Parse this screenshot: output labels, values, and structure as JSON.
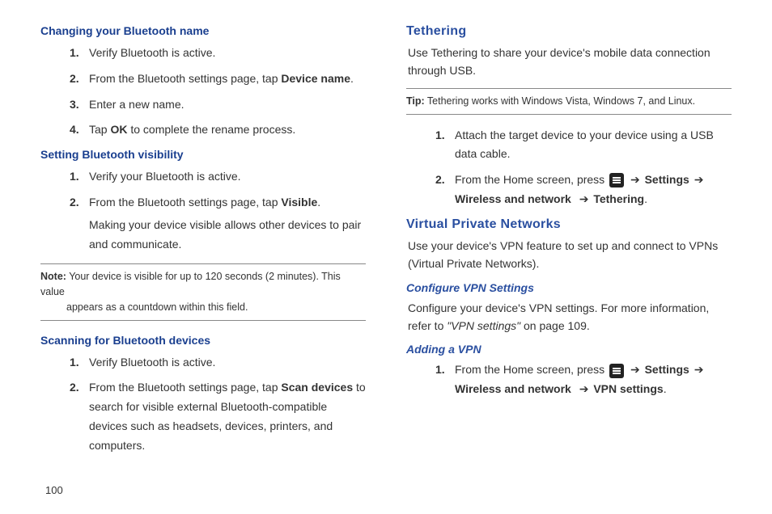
{
  "left": {
    "sec1": {
      "heading": "Changing your Bluetooth name",
      "items": [
        {
          "n": "1.",
          "t": "Verify Bluetooth is active."
        },
        {
          "n": "2.",
          "pre": "From the Bluetooth settings page, tap ",
          "bold": "Device name",
          "post": "."
        },
        {
          "n": "3.",
          "t": "Enter a new name."
        },
        {
          "n": "4.",
          "pre": "Tap ",
          "bold": "OK",
          "post": " to complete the rename process."
        }
      ]
    },
    "sec2": {
      "heading": "Setting Bluetooth visibility",
      "items": [
        {
          "n": "1.",
          "t": "Verify your Bluetooth is active."
        },
        {
          "n": "2.",
          "pre": "From the Bluetooth settings page, tap ",
          "bold": "Visible",
          "post": ".",
          "cont": "Making your device visible allows other devices to pair and communicate."
        }
      ]
    },
    "note": {
      "label": "Note:",
      "line1": " Your device is visible for up to 120 seconds (2 minutes). This value",
      "line2": "appears as a countdown within this field."
    },
    "sec3": {
      "heading": "Scanning for Bluetooth devices",
      "items": [
        {
          "n": "1.",
          "t": "Verify Bluetooth is active."
        },
        {
          "n": "2.",
          "pre": "From the Bluetooth settings page, tap ",
          "bold": "Scan devices",
          "post": " to search for visible external Bluetooth-compatible devices such as headsets, devices, printers, and computers."
        }
      ]
    }
  },
  "right": {
    "teth": {
      "heading": "Tethering",
      "desc": "Use Tethering to share your device's mobile data connection through USB."
    },
    "tip": {
      "label": "Tip:",
      "text": " Tethering works with Windows Vista, Windows 7, and Linux."
    },
    "tethlist": {
      "item1": {
        "n": "1.",
        "t": "Attach the target device to your device using a USB data cable."
      },
      "item2": {
        "n": "2.",
        "pre": "From the Home screen, press ",
        "arrow": "➔",
        "p1": "Settings",
        "p2": "Wireless and network",
        "p3": "Tethering",
        "dot": "."
      }
    },
    "vpn": {
      "heading": "Virtual Private Networks",
      "desc": "Use your device's VPN feature to set up and connect to VPNs (Virtual Private Networks)."
    },
    "conf": {
      "heading": "Configure VPN Settings",
      "pre": "Configure your device's VPN settings. For more information, refer to ",
      "ref": "\"VPN settings\"",
      "post": "  on page 109."
    },
    "add": {
      "heading": "Adding a VPN",
      "item": {
        "n": "1.",
        "pre": "From the Home screen, press ",
        "arrow": "➔",
        "p1": "Settings",
        "p2": "Wireless and network",
        "p3": "VPN settings",
        "dot": "."
      }
    }
  },
  "page": "100"
}
